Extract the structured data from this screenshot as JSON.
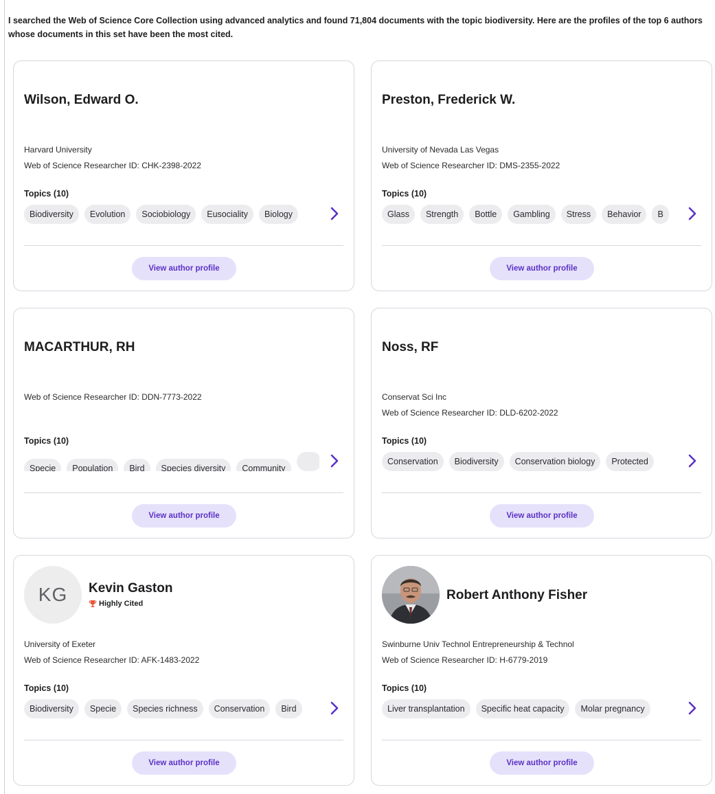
{
  "intro": "I searched the Web of Science Core Collection using advanced analytics and found 71,804 documents with the topic biodiversity. Here are the profiles of the top 6 authors whose documents in this set have been the most cited.",
  "button_label": "View author profile",
  "accent_color": "#5b32c4",
  "cards": [
    {
      "name": "Wilson, Edward O.",
      "affiliation": "Harvard University",
      "researcher_id": "Web of Science Researcher ID: CHK-2398-2022",
      "topics_label": "Topics (10)",
      "topics": [
        "Biodiversity",
        "Evolution",
        "Sociobiology",
        "Eusociality",
        "Biology"
      ]
    },
    {
      "name": "Preston, Frederick W.",
      "affiliation": "University of Nevada Las Vegas",
      "researcher_id": "Web of Science Researcher ID: DMS-2355-2022",
      "topics_label": "Topics (10)",
      "topics": [
        "Glass",
        "Strength",
        "Bottle",
        "Gambling",
        "Stress",
        "Behavior",
        "B"
      ]
    },
    {
      "name": "MACARTHUR, RH",
      "researcher_id": "Web of Science Researcher ID: DDN-7773-2022",
      "topics_label": "Topics (10)",
      "topics": [
        "Specie",
        "Population",
        "Bird",
        "Species diversity",
        "Community",
        ""
      ]
    },
    {
      "name": "Noss, RF",
      "affiliation": "Conservat Sci Inc",
      "researcher_id": "Web of Science Researcher ID: DLD-6202-2022",
      "topics_label": "Topics (10)",
      "topics": [
        "Conservation",
        "Biodiversity",
        "Conservation biology",
        "Protected"
      ]
    },
    {
      "name": "Kevin Gaston",
      "initials": "KG",
      "badge": "Highly Cited",
      "affiliation": "University of Exeter",
      "researcher_id": "Web of Science Researcher ID: AFK-1483-2022",
      "topics_label": "Topics (10)",
      "topics": [
        "Biodiversity",
        "Specie",
        "Species richness",
        "Conservation",
        "Bird"
      ]
    },
    {
      "name": "Robert Anthony Fisher",
      "affiliation": "Swinburne Univ Technol Entrepreneurship & Technol",
      "researcher_id": "Web of Science Researcher ID: H-6779-2019",
      "topics_label": "Topics (10)",
      "topics": [
        "Liver transplantation",
        "Specific heat capacity",
        "Molar pregnancy"
      ]
    }
  ]
}
